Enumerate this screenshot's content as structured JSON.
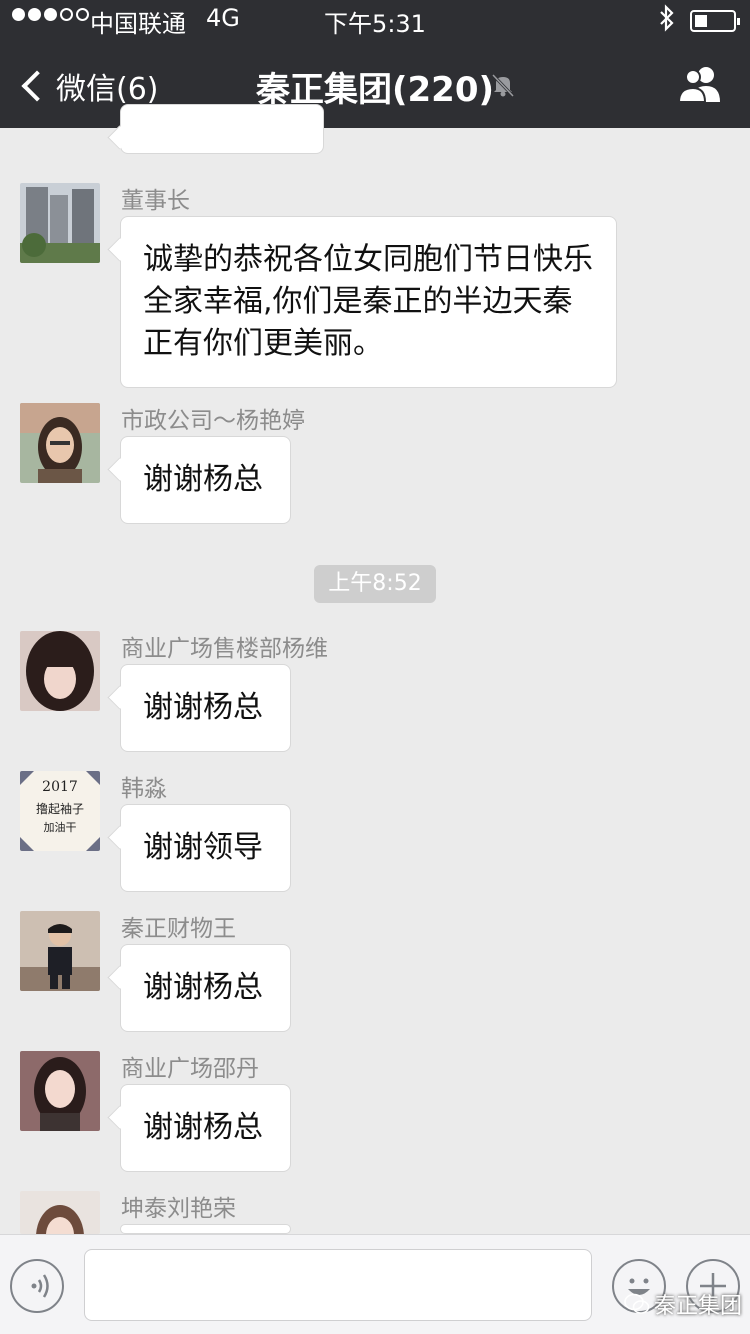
{
  "status": {
    "carrier": "中国联通",
    "network": "4G",
    "time": "下午5:31"
  },
  "nav": {
    "back_label": "微信(6)",
    "title": "秦正集团(220)"
  },
  "messages": [
    {
      "name": "董事长",
      "text": "诚挚的恭祝各位女同胞们节日快乐全家幸福,你们是秦正的半边天秦正有你们更美丽。"
    },
    {
      "name": "市政公司～杨艳婷",
      "text": "谢谢杨总"
    },
    {
      "name": "商业广场售楼部杨维",
      "text": "谢谢杨总"
    },
    {
      "name": "韩淼",
      "text": "谢谢领导"
    },
    {
      "name": "秦正财物王",
      "text": "谢谢杨总"
    },
    {
      "name": "商业广场邵丹",
      "text": "谢谢杨总"
    },
    {
      "name": "坤泰刘艳荣",
      "text": ""
    }
  ],
  "time_separator": "上午8:52",
  "avatar_text": {
    "year": "2017",
    "line1": "撸起袖子",
    "line2": "加油干"
  },
  "watermark": "秦正集团",
  "colors": {
    "nav_bg": "#2e2f33",
    "chat_bg": "#ebebeb",
    "bubble_bg": "#ffffff"
  }
}
